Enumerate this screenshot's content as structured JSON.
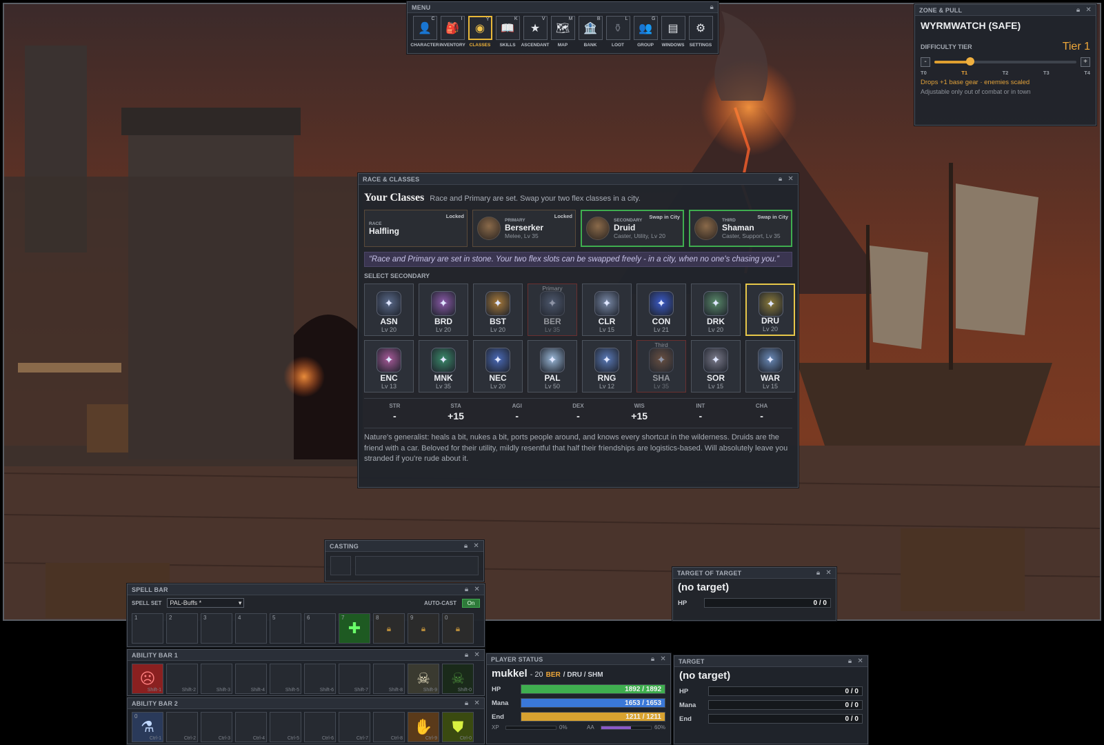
{
  "menu": {
    "title": "MENU",
    "buttons": [
      {
        "label": "CHARACTER",
        "key": "C",
        "glyph": "👤"
      },
      {
        "label": "INVENTORY",
        "key": "I",
        "glyph": "🎒"
      },
      {
        "label": "CLASSES",
        "key": "Y",
        "glyph": "◉"
      },
      {
        "label": "SKILLS",
        "key": "K",
        "glyph": "📖"
      },
      {
        "label": "ASCENDANT",
        "key": "V",
        "glyph": "★"
      },
      {
        "label": "MAP",
        "key": "M",
        "glyph": "🗺"
      },
      {
        "label": "BANK",
        "key": "B",
        "glyph": "🏦"
      },
      {
        "label": "LOOT",
        "key": "L",
        "glyph": "⚱"
      },
      {
        "label": "GROUP",
        "key": "G",
        "glyph": "👥"
      },
      {
        "label": "WINDOWS",
        "key": "",
        "glyph": "▤"
      },
      {
        "label": "SETTINGS",
        "key": "",
        "glyph": "⚙"
      }
    ]
  },
  "zone": {
    "header": "ZONE & PULL",
    "name": "WYRMWATCH (SAFE)",
    "difficulty_label": "DIFFICULTY TIER",
    "tier": "Tier 1",
    "minus": "-",
    "plus": "+",
    "ticks": [
      "T0",
      "T1",
      "T2",
      "T3",
      "T4"
    ],
    "level_fraction": 0.25,
    "note1": "Drops +1 base gear · enemies scaled",
    "note2": "Adjustable only out of combat or in town"
  },
  "classes": {
    "header": "RACE & CLASSES",
    "title": "Your Classes",
    "subtitle": "Race and Primary are set. Swap your two flex classes in a city.",
    "slots": [
      {
        "label": "RACE",
        "tag": "Locked",
        "name": "Halfling",
        "meta": ""
      },
      {
        "label": "PRIMARY",
        "tag": "Locked",
        "name": "Berserker",
        "meta": "Melee, Lv 35"
      },
      {
        "label": "SECONDARY",
        "tag": "Swap in City",
        "name": "Druid",
        "meta": "Caster, Utility, Lv 20"
      },
      {
        "label": "THIRD",
        "tag": "Swap in City",
        "name": "Shaman",
        "meta": "Caster, Support, Lv 35"
      }
    ],
    "quote": "“Race and Primary are set in stone. Your two flex slots can be swapped freely - in a city, when no one's chasing you.”",
    "select_label": "SELECT SECONDARY",
    "grid": [
      {
        "abbr": "ASN",
        "lv": "Lv 20",
        "note": ""
      },
      {
        "abbr": "BRD",
        "lv": "Lv 20",
        "note": ""
      },
      {
        "abbr": "BST",
        "lv": "Lv 20",
        "note": ""
      },
      {
        "abbr": "BER",
        "lv": "Lv 35",
        "note": "Primary"
      },
      {
        "abbr": "CLR",
        "lv": "Lv 15",
        "note": ""
      },
      {
        "abbr": "CON",
        "lv": "Lv 21",
        "note": ""
      },
      {
        "abbr": "DRK",
        "lv": "Lv 20",
        "note": ""
      },
      {
        "abbr": "DRU",
        "lv": "Lv 20",
        "note": ""
      },
      {
        "abbr": "ENC",
        "lv": "Lv 13",
        "note": ""
      },
      {
        "abbr": "MNK",
        "lv": "Lv 35",
        "note": ""
      },
      {
        "abbr": "NEC",
        "lv": "Lv 20",
        "note": ""
      },
      {
        "abbr": "PAL",
        "lv": "Lv 50",
        "note": ""
      },
      {
        "abbr": "RNG",
        "lv": "Lv 12",
        "note": ""
      },
      {
        "abbr": "SHA",
        "lv": "Lv 35",
        "note": "Third"
      },
      {
        "abbr": "SOR",
        "lv": "Lv 15",
        "note": ""
      },
      {
        "abbr": "WAR",
        "lv": "Lv 15",
        "note": ""
      }
    ],
    "stats": [
      {
        "k": "STR",
        "v": "-"
      },
      {
        "k": "STA",
        "v": "+15"
      },
      {
        "k": "AGI",
        "v": "-"
      },
      {
        "k": "DEX",
        "v": "-"
      },
      {
        "k": "WIS",
        "v": "+15"
      },
      {
        "k": "INT",
        "v": "-"
      },
      {
        "k": "CHA",
        "v": "-"
      }
    ],
    "description": "Nature's generalist: heals a bit, nukes a bit, ports people around, and knows every shortcut in the wilderness. Druids are the friend with a car. Beloved for their utility, mildly resentful that half their friendships are logistics-based. Will absolutely leave you stranded if you're rude about it."
  },
  "casting": {
    "header": "CASTING"
  },
  "spellbar": {
    "header": "SPELL BAR",
    "set_label": "SPELL SET",
    "set_value": "PAL-Buffs *",
    "autocast_label": "AUTO-CAST",
    "autocast_value": "On",
    "slots": [
      "1",
      "2",
      "3",
      "4",
      "5",
      "6",
      "7",
      "8",
      "9",
      "0"
    ]
  },
  "ability1": {
    "header": "ABILITY BAR 1",
    "keys": [
      "Shift-1",
      "Shift-2",
      "Shift-3",
      "Shift-4",
      "Shift-5",
      "Shift-6",
      "Shift-7",
      "Shift-8",
      "Shift-9",
      "Shift-0"
    ]
  },
  "ability2": {
    "header": "ABILITY BAR 2",
    "first": "0",
    "keys": [
      "Ctrl-1",
      "Ctrl-2",
      "Ctrl-3",
      "Ctrl-4",
      "Ctrl-5",
      "Ctrl-6",
      "Ctrl-7",
      "Ctrl-8",
      "Ctrl-9",
      "Ctrl-0"
    ]
  },
  "player": {
    "header": "PLAYER STATUS",
    "name": "mukkel",
    "level": "- 20",
    "primary": "BER",
    "others": "/ DRU / SHM",
    "hp_label": "HP",
    "hp": "1892 / 1892",
    "hp_fraction": 1.0,
    "mana_label": "Mana",
    "mana": "1653 / 1653",
    "mana_fraction": 1.0,
    "end_label": "End",
    "end": "1211 / 1211",
    "end_fraction": 1.0,
    "xp_label": "XP",
    "xp_pct": "0%",
    "xp_fraction": 0.0,
    "aa_label": "AA",
    "aa_pct": "60%",
    "aa_fraction": 0.6
  },
  "tot": {
    "header": "TARGET OF TARGET",
    "name": "(no target)",
    "hp_label": "HP",
    "hp": "0 / 0"
  },
  "target": {
    "header": "TARGET",
    "name": "(no target)",
    "hp_label": "HP",
    "hp": "0 / 0",
    "mana_label": "Mana",
    "mana": "0 / 0",
    "end_label": "End",
    "end": "0 / 0"
  },
  "colors": {
    "accent": "#e8b83a",
    "hp": "#3fae4f",
    "mana": "#3a78d8",
    "end": "#d8a230",
    "aa": "#8a5ac8"
  }
}
